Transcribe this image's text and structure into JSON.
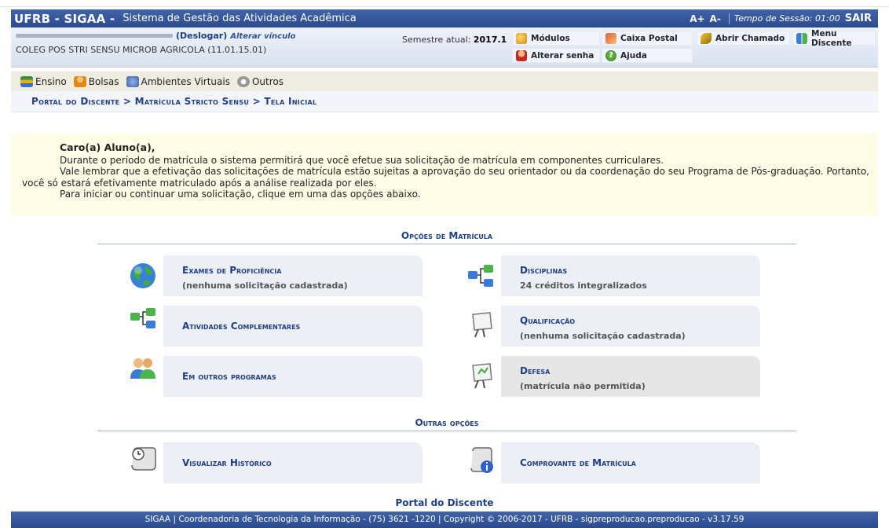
{
  "header": {
    "brand": "UFRB - SIGAA -",
    "system_name": "Sistema de Gestão das Atividades Acadêmica",
    "font_increase": "A+",
    "font_decrease": "A-",
    "session": "Tempo de Sessão: 01:00",
    "logout": "SAIR"
  },
  "user": {
    "logout_link": "(Deslogar)",
    "change_link": "Alterar vínculo",
    "course": "COLEG POS STRI SENSU MICROB AGRICOLA (11.01.15.01)",
    "semester_label": "Semestre atual:",
    "semester_value": "2017.1"
  },
  "quick_menu": [
    {
      "label": "Módulos",
      "icon": "modules-icon"
    },
    {
      "label": "Caixa Postal",
      "icon": "mailbox-icon"
    },
    {
      "label": "Abrir Chamado",
      "icon": "ticket-icon"
    },
    {
      "label": "Menu Discente",
      "icon": "student-menu-icon"
    },
    {
      "label": "Alterar senha",
      "icon": "password-icon"
    },
    {
      "label": "Ajuda",
      "icon": "help-icon"
    }
  ],
  "nav": [
    {
      "label": "Ensino",
      "icon": "books-icon"
    },
    {
      "label": "Bolsas",
      "icon": "person-icon"
    },
    {
      "label": "Ambientes Virtuais",
      "icon": "network-icon"
    },
    {
      "label": "Outros",
      "icon": "gear-icon"
    }
  ],
  "breadcrumb": "Portal do Discente > Matrícula Stricto Sensu > Tela Inicial",
  "notice": {
    "greeting": "Caro(a) Aluno(a),",
    "line1": "Durante o período de matrícula o sistema permitirá que você efetue sua solicitação de matrícula em componentes curriculares.",
    "line2": "Vale lembrar que a efetivação das solicitações de matrícula estão sujeitas a aprovação do seu orientador ou da coordenação do seu Programa de Pós-graduação. Portanto, você só estará efetivamente matriculado após a análise realizada por eles.",
    "line3": "Para iniciar ou continuar uma solicitação, clique em uma das opções abaixo."
  },
  "options_title": "Opções de Matrícula",
  "options": [
    {
      "title": "Exames de Proficiência",
      "subtitle": "(nenhuma solicitação cadastrada)",
      "icon": "globe-icon"
    },
    {
      "title": "Disciplinas",
      "subtitle": "24 créditos integralizados",
      "icon": "tree-icon"
    },
    {
      "title": "Atividades Complementares",
      "subtitle": "",
      "icon": "tree-icon"
    },
    {
      "title": "Qualificação",
      "subtitle": "(nenhuma solicitação cadastrada)",
      "icon": "presentation-board-icon"
    },
    {
      "title": "Em outros programas",
      "subtitle": "",
      "icon": "users-icon"
    },
    {
      "title": "Defesa",
      "subtitle": "(matrícula não permitida)",
      "icon": "presentation-board-icon"
    }
  ],
  "other_title": "Outras opções",
  "other_options": [
    {
      "title": "Visualizar Histórico",
      "icon": "history-scroll-icon"
    },
    {
      "title": "Comprovante de Matrícula",
      "icon": "receipt-info-icon"
    }
  ],
  "footer": {
    "title": "Portal do Discente",
    "text": "SIGAA | Coordenadoria de Tecnologia da Informação - (75) 3621 -1220 | Copyright © 2006-2017 - UFRB - sigpreproducao.preproducao - v3.17.59"
  },
  "colors": {
    "header_blue": "#2c4b8e",
    "link_blue": "#1e3f88",
    "notice_bg": "#fffde6",
    "card_bg": "#eceff6"
  }
}
